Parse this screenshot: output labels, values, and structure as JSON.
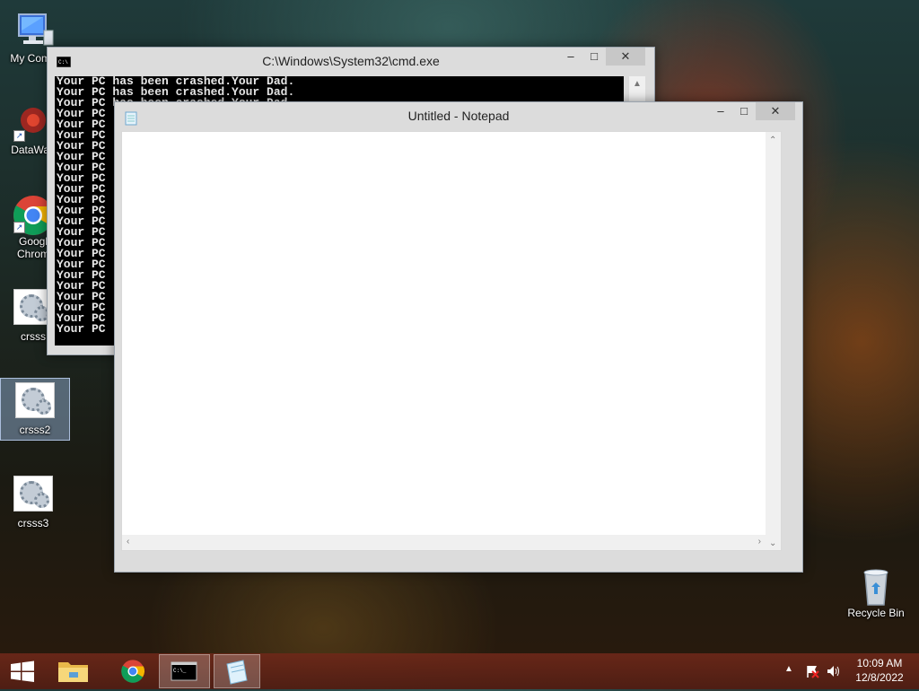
{
  "desktop": {
    "icons": [
      {
        "label": "My Comp",
        "icon": "computer-icon"
      },
      {
        "label": "DataWag",
        "icon": "datawag-app-icon"
      },
      {
        "label": "Googl\nChrom",
        "icon": "chrome-icon"
      },
      {
        "label": "crsss",
        "icon": "config-gear-icon"
      },
      {
        "label": "crsss2",
        "icon": "config-gear-icon"
      },
      {
        "label": "crsss3",
        "icon": "config-gear-icon"
      },
      {
        "label": "Recycle Bin",
        "icon": "recycle-bin-icon"
      }
    ]
  },
  "cmd": {
    "title": "C:\\Windows\\System32\\cmd.exe",
    "output": "Your PC has been crashed.Your Dad.\nYour PC has been crashed.Your Dad.\nYour PC has been crashed.Your Dad.\nYour PC\nYour PC\nYour PC\nYour PC\nYour PC\nYour PC\nYour PC\nYour PC\nYour PC\nYour PC\nYour PC\nYour PC\nYour PC\nYour PC\nYour PC\nYour PC\nYour PC\nYour PC\nYour PC\nYour PC\nYour PC"
  },
  "notepad": {
    "title": "Untitled - Notepad",
    "content": ""
  },
  "window_controls": {
    "minimize": "–",
    "maximize": "□",
    "close": "✕"
  },
  "taskbar": {
    "items": [
      "start-button",
      "file-explorer",
      "chrome",
      "command-prompt",
      "notepad"
    ],
    "time": "10:09 AM",
    "date": "12/8/2022"
  },
  "colors": {
    "taskbar": "#6e2819",
    "console_bg": "#000000",
    "console_fg": "#e8e8e8",
    "selection": "#a0bee6"
  }
}
